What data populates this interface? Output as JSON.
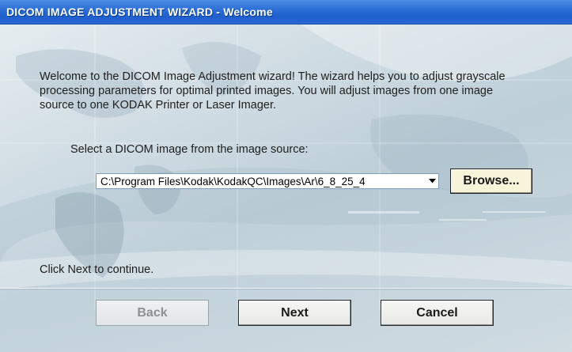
{
  "window": {
    "title": "DICOM IMAGE ADJUSTMENT WIZARD - Welcome"
  },
  "intro": {
    "welcome_text": "Welcome to the DICOM Image Adjustment wizard! The wizard helps you to adjust grayscale processing parameters for optimal printed images. You will adjust images from one image source to one KODAK Printer or Laser Imager.",
    "select_label": "Select a DICOM image from the image source:",
    "image_path": "C:\\Program Files\\Kodak\\KodakQC\\Images\\Ar\\6_8_25_4",
    "browse_label": "Browse...",
    "continue_hint": "Click Next to continue."
  },
  "buttons": {
    "back_label": "Back",
    "next_label": "Next",
    "cancel_label": "Cancel"
  },
  "icons": {
    "dropdown": "chevron-down-icon",
    "background": "world-map-graphic"
  },
  "colors": {
    "titlebar": "#2c6fd6",
    "browse_background": "#f7f4d9",
    "disabled_text": "#8f8f8f"
  }
}
